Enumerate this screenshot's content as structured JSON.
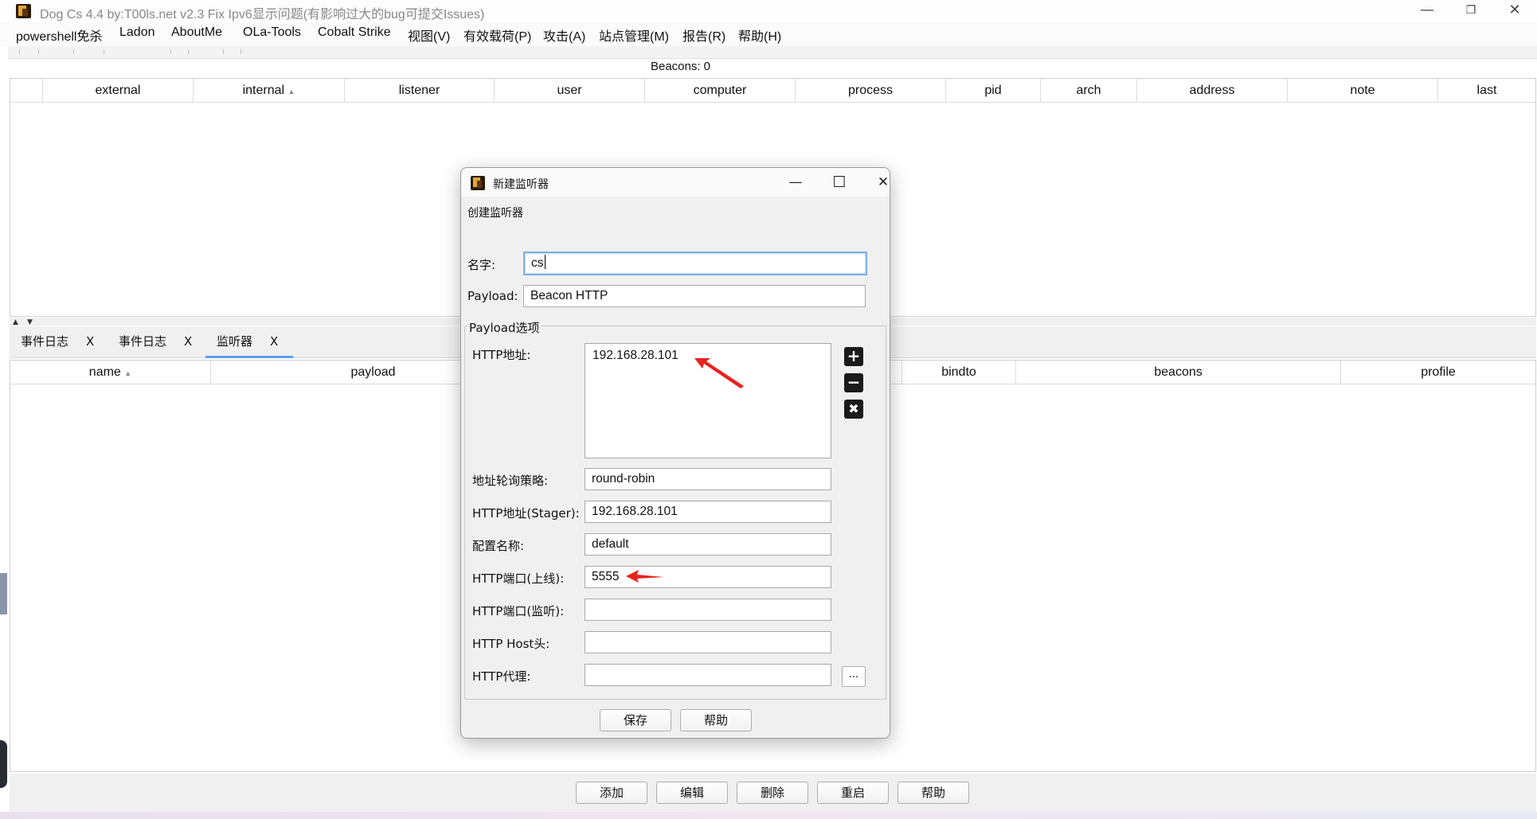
{
  "app": {
    "title": "Dog Cs 4.4 by:T00ls.net v2.3 Fix Ipv6显示问题(有影响过大的bug可提交Issues)",
    "window_controls": {
      "minimize": "—",
      "restore": "❐",
      "close": "✕"
    }
  },
  "menubar": {
    "items": [
      "powershell免杀",
      "Ladon",
      "AboutMe",
      "OLa-Tools",
      "Cobalt Strike",
      "视图(V)",
      "有效载荷(P)",
      "攻击(A)",
      "站点管理(M)",
      "报告(R)",
      "帮助(H)"
    ]
  },
  "beacons": {
    "label": "Beacons: 0",
    "columns": [
      "",
      "external",
      "internal",
      "listener",
      "user",
      "computer",
      "process",
      "pid",
      "arch",
      "address",
      "note",
      "last"
    ],
    "sorted_column": "internal",
    "rows": []
  },
  "tabs": [
    {
      "label": "事件日志",
      "close": "X",
      "active": false
    },
    {
      "label": "事件日志",
      "close": "X",
      "active": false
    },
    {
      "label": "监听器",
      "close": "X",
      "active": true
    }
  ],
  "listeners": {
    "columns": [
      "name",
      "payload",
      "",
      "bindto",
      "beacons",
      "profile"
    ],
    "sorted_column": "name",
    "rows": []
  },
  "bottom_buttons": [
    "添加",
    "编辑",
    "删除",
    "重启",
    "帮助"
  ],
  "dialog": {
    "title": "新建监听器",
    "subtitle": "创建监听器",
    "controls": {
      "minimize": "—",
      "maximize": "☐",
      "close": "✕"
    },
    "name_label": "名字:",
    "name_value": "cs",
    "payload_label": "Payload:",
    "payload_value": "Beacon HTTP",
    "group_title": "Payload选项",
    "http_hosts_label": "HTTP地址:",
    "http_hosts": [
      "192.168.28.101"
    ],
    "list_buttons": {
      "add": "+",
      "remove": "−",
      "clear": "✖"
    },
    "rotate_label": "地址轮询策略:",
    "rotate_value": "round-robin",
    "stager_label": "HTTP地址(Stager):",
    "stager_value": "192.168.28.101",
    "profile_label": "配置名称:",
    "profile_value": "default",
    "port_label": "HTTP端口(上线):",
    "port_value": "5555",
    "bind_label": "HTTP端口(监听):",
    "bind_value": "",
    "host_header_label": "HTTP Host头:",
    "host_header_value": "",
    "proxy_label": "HTTP代理:",
    "proxy_value": "",
    "proxy_button": "...",
    "save_button": "保存",
    "help_button": "帮助"
  },
  "colors": {
    "annotation_arrow": "#e8231f",
    "focus_border": "#7fb0e6",
    "tab_underline": "#5aa0ff"
  }
}
